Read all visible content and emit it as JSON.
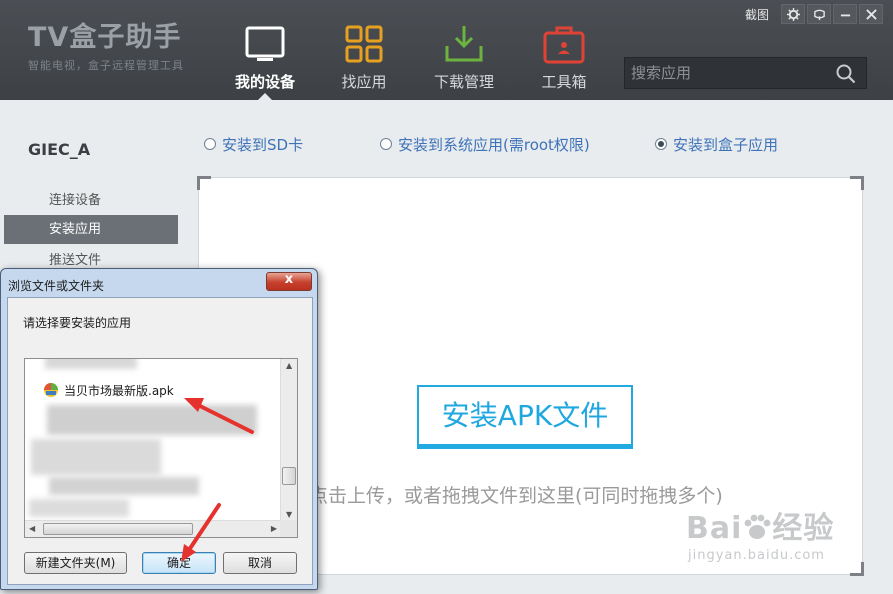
{
  "app": {
    "logo_title": "TV盒子助手",
    "logo_subtitle": "智能电视，盒子远程管理工具"
  },
  "nav": [
    {
      "label": "我的设备",
      "icon": "tv-screen-icon",
      "active": true
    },
    {
      "label": "找应用",
      "icon": "app-grid-icon",
      "active": false
    },
    {
      "label": "下载管理",
      "icon": "download-tray-icon",
      "active": false
    },
    {
      "label": "工具箱",
      "icon": "toolbox-icon",
      "active": false
    }
  ],
  "window": {
    "screenshot_label": "截图",
    "controls": [
      "gear-icon",
      "skin-icon",
      "minimize-icon",
      "close-icon"
    ]
  },
  "search": {
    "placeholder": "搜索应用",
    "value": ""
  },
  "sidebar": {
    "device_name": "GIEC_A",
    "items": [
      {
        "label": "连接设备",
        "active": false
      },
      {
        "label": "安装应用",
        "active": true
      },
      {
        "label": "推送文件",
        "active": false
      }
    ]
  },
  "install": {
    "options": [
      {
        "label": "安装到SD卡",
        "checked": false
      },
      {
        "label": "安装到系统应用(需root权限)",
        "checked": false
      },
      {
        "label": "安装到盒子应用",
        "checked": true
      }
    ],
    "button_label": "安装APK文件",
    "hint": "点击上传，或者拖拽文件到这里(可同时拖拽多个)"
  },
  "dialog": {
    "title": "浏览文件或文件夹",
    "prompt": "请选择要安装的应用",
    "selected_file": "当贝市场最新版.apk",
    "new_folder_label": "新建文件夹(M)",
    "ok_label": "确定",
    "cancel_label": "取消"
  },
  "watermark": {
    "brand": "Bai",
    "suffix": "经验",
    "url": "jingyan.baidu.com"
  },
  "colors": {
    "header_bg": "#444950",
    "panel_bg": "#e9ecef",
    "accent_blue": "#21a9e1",
    "link_blue": "#3e73b8",
    "annotation_red": "#e5322d",
    "nav_orange": "#e8a020",
    "nav_green": "#6cb33f",
    "nav_red": "#e04236"
  }
}
